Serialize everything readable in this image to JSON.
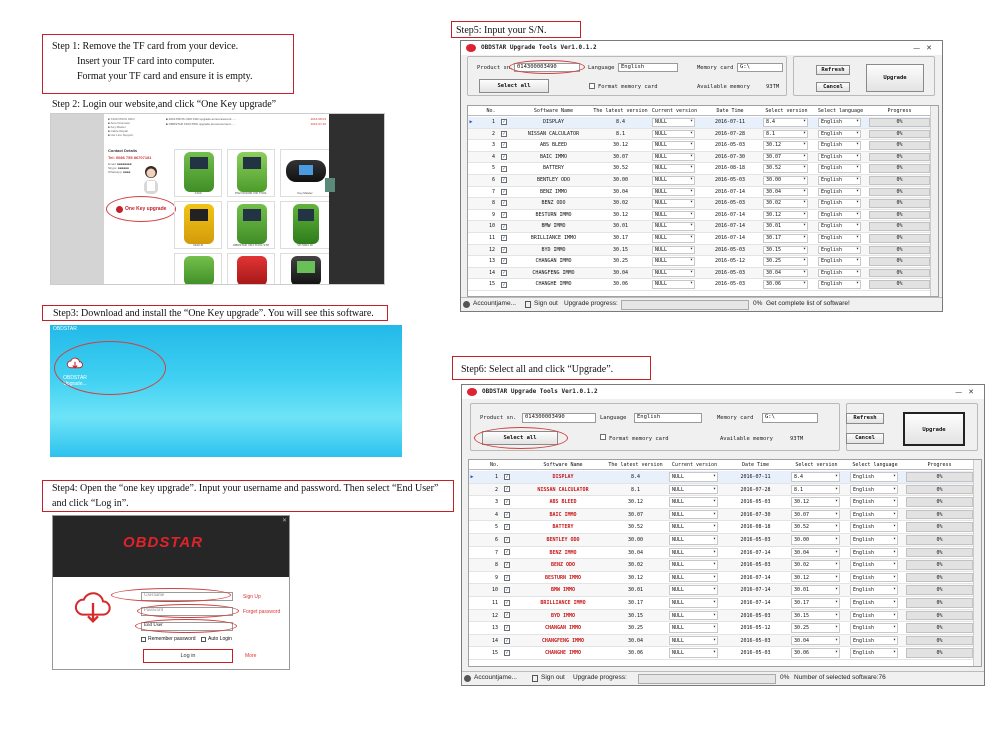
{
  "steps": {
    "step1": {
      "line1": "Step 1: Remove the TF card from your device.",
      "line2": "Insert your TF card into computer.",
      "line3": "Format your TF card and ensure it is empty."
    },
    "step2": "Step 2: Login our website,and click “One Key upgrade”",
    "step3": "Step3: Download and install the “One Key upgrade”. You will see this software.",
    "step4": "Step4: Open the “one key upgrade”. Input your username and password. Then select “End User” and click “Log in”.",
    "step5": "Step5: Input your S/N.",
    "step6": "Step6: Select all and click “Upgrade”."
  },
  "website": {
    "contact_title": "Contact Details",
    "phone": "Tel: 0086 755 86707181",
    "one_key_label": "One Key upgrade",
    "product_labels": [
      "X100",
      "PS2 FR1000 VID TOOL",
      "Key Master",
      "X100 III",
      "OBDSTAR VD4 TOOL STP",
      "VD 5001 ID"
    ]
  },
  "desktop": {
    "top_label": "OBDSTAR",
    "icon_label": "OBDSTAR Upgrade..."
  },
  "login": {
    "brand": "OBDSTAR",
    "username_placeholder": "Username",
    "password_placeholder": "Password",
    "usertype": "End User",
    "signup": "Sign Up",
    "forgot": "Forget password",
    "remember": "Remember password",
    "autologin": "Auto Login",
    "login_btn": "Log in",
    "more": "More"
  },
  "app": {
    "title": "OBDSTAR Upgrade Tools Ver1.0.1.2",
    "product_sn_label": "Product sn.",
    "product_sn": "014300003490",
    "language_label": "Language",
    "language": "English",
    "memory_card_label": "Memory card",
    "memory_card": "G:\\",
    "available_memory_label": "Available memory",
    "available_memory": "93TM",
    "format_label": "Format memory card",
    "select_all": "Select all",
    "refresh": "Refresh",
    "cancel": "Cancel",
    "upgrade": "Upgrade",
    "columns": [
      "No.",
      "Software Name",
      "The latest version",
      "Current version",
      "Date Time",
      "Select version",
      "Select language",
      "Progress"
    ],
    "rows": [
      {
        "no": "1",
        "name": "DISPLAY",
        "latest": "8.4",
        "current": "NULL",
        "date": "2016-07-11",
        "select": "8.4",
        "lang": "English",
        "progress": "0%"
      },
      {
        "no": "2",
        "name": "NISSAN CALCULATOR",
        "latest": "8.1",
        "current": "NULL",
        "date": "2016-07-28",
        "select": "8.1",
        "lang": "English",
        "progress": "0%"
      },
      {
        "no": "3",
        "name": "ABS BLEED",
        "latest": "30.12",
        "current": "NULL",
        "date": "2016-05-03",
        "select": "30.12",
        "lang": "English",
        "progress": "0%"
      },
      {
        "no": "4",
        "name": "BAIC IMMO",
        "latest": "30.07",
        "current": "NULL",
        "date": "2016-07-30",
        "select": "30.07",
        "lang": "English",
        "progress": "0%"
      },
      {
        "no": "5",
        "name": "BATTERY",
        "latest": "30.52",
        "current": "NULL",
        "date": "2016-08-18",
        "select": "30.52",
        "lang": "English",
        "progress": "0%"
      },
      {
        "no": "6",
        "name": "BENTLEY ODO",
        "latest": "30.00",
        "current": "NULL",
        "date": "2016-05-03",
        "select": "30.00",
        "lang": "English",
        "progress": "0%"
      },
      {
        "no": "7",
        "name": "BENZ IMMO",
        "latest": "30.04",
        "current": "NULL",
        "date": "2016-07-14",
        "select": "30.04",
        "lang": "English",
        "progress": "0%"
      },
      {
        "no": "8",
        "name": "BENZ ODO",
        "latest": "30.02",
        "current": "NULL",
        "date": "2016-05-03",
        "select": "30.02",
        "lang": "English",
        "progress": "0%"
      },
      {
        "no": "9",
        "name": "BESTURN IMMO",
        "latest": "30.12",
        "current": "NULL",
        "date": "2016-07-14",
        "select": "30.12",
        "lang": "English",
        "progress": "0%"
      },
      {
        "no": "10",
        "name": "BMW IMMO",
        "latest": "30.01",
        "current": "NULL",
        "date": "2016-07-14",
        "select": "30.01",
        "lang": "English",
        "progress": "0%"
      },
      {
        "no": "11",
        "name": "BRILLIANCE IMMO",
        "latest": "30.17",
        "current": "NULL",
        "date": "2016-07-14",
        "select": "30.17",
        "lang": "English",
        "progress": "0%"
      },
      {
        "no": "12",
        "name": "BYD IMMO",
        "latest": "30.15",
        "current": "NULL",
        "date": "2016-05-03",
        "select": "30.15",
        "lang": "English",
        "progress": "0%"
      },
      {
        "no": "13",
        "name": "CHANGAN IMMO",
        "latest": "30.25",
        "current": "NULL",
        "date": "2016-05-12",
        "select": "30.25",
        "lang": "English",
        "progress": "0%"
      },
      {
        "no": "14",
        "name": "CHANGFENG IMMO",
        "latest": "30.04",
        "current": "NULL",
        "date": "2016-05-03",
        "select": "30.04",
        "lang": "English",
        "progress": "0%"
      },
      {
        "no": "15",
        "name": "CHANGHE IMMO",
        "latest": "30.06",
        "current": "NULL",
        "date": "2016-05-03",
        "select": "30.06",
        "lang": "English",
        "progress": "0%"
      }
    ],
    "status": {
      "account": "Accountjame...",
      "signout": "Sign out",
      "progress_label": "Upgrade progress:",
      "pct": "0%",
      "msg_step5": "Get complete list of software!",
      "msg_step6": "Number of selected software:76"
    }
  },
  "colors": {
    "accent_red": "#c4202a",
    "selected_red": "#c81818",
    "app_bg": "#f0f0f0"
  }
}
